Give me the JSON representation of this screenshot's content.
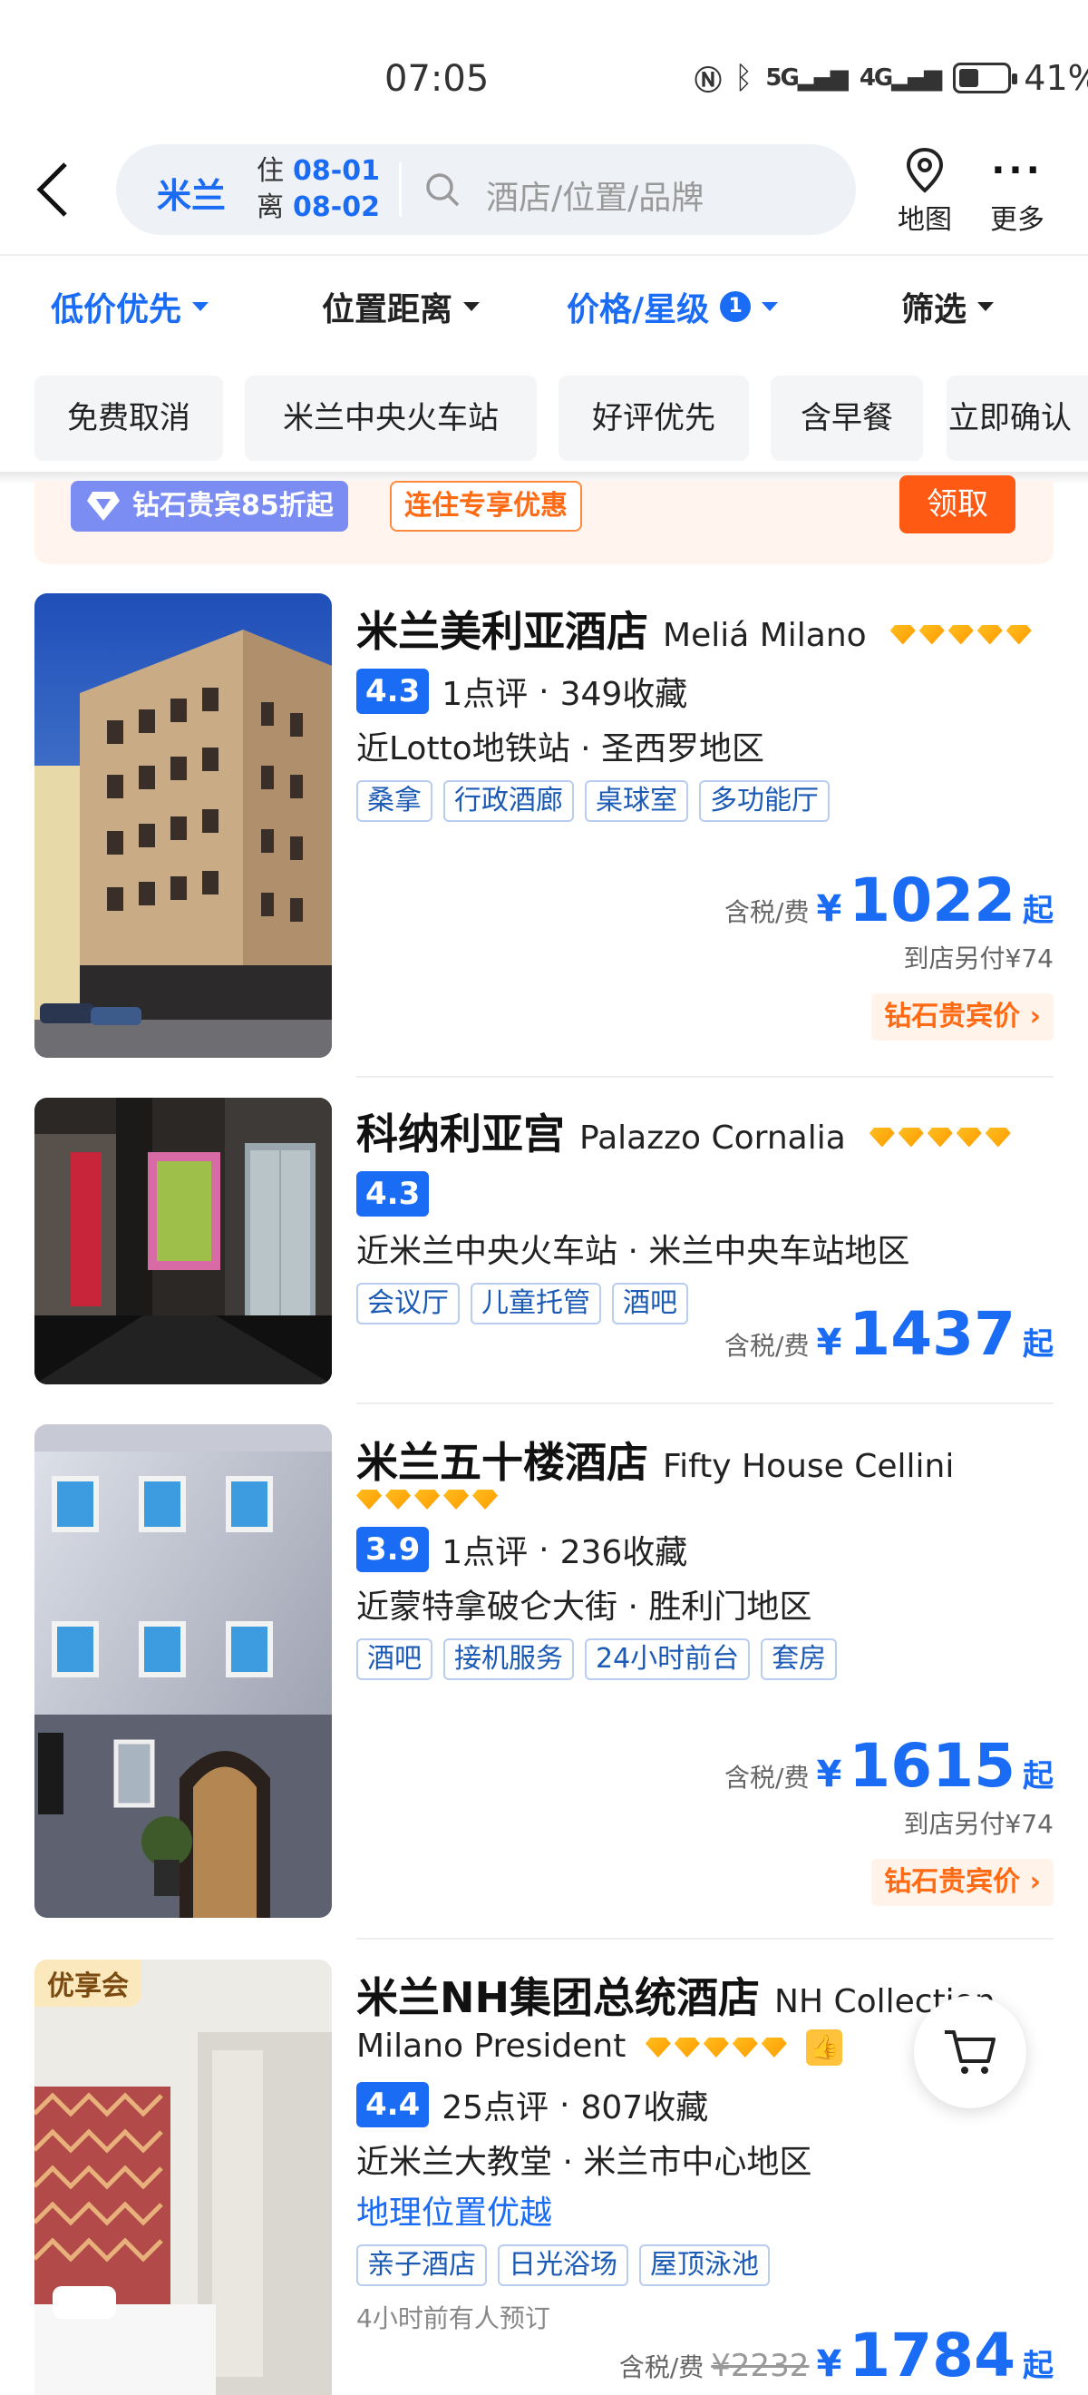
{
  "status_bar": {
    "time": "07:05",
    "battery_pct": "41%",
    "battery_level": 0.41,
    "signal_5g": "5G",
    "signal_4g": "4G"
  },
  "header": {
    "city": "米兰",
    "checkin_label": "住",
    "checkin_date": "08-01",
    "checkout_label": "离",
    "checkout_date": "08-02",
    "search_placeholder": "酒店/位置/品牌",
    "map_label": "地图",
    "more_label": "更多"
  },
  "filters": [
    {
      "label": "低价优先"
    },
    {
      "label": "位置距离"
    },
    {
      "label": "价格/星级",
      "badge": "1"
    },
    {
      "label": "筛选"
    }
  ],
  "quick_tags": [
    "免费取消",
    "米兰中央火车站",
    "好评优先",
    "含早餐",
    "立即确认"
  ],
  "promo": {
    "diamond": "钻石贵宾85折起",
    "stay": "连住专享优惠",
    "claim": "领取"
  },
  "common": {
    "tax_label": "含税/费",
    "currency": "¥",
    "qi": "起",
    "vip_price": "钻石贵宾价 ›"
  },
  "hotels": [
    {
      "name": "米兰美利亚酒店",
      "name_en": "Meliá Milano",
      "stars": 5,
      "score": "4.3",
      "reviews": "1点评",
      "favorites": "349收藏",
      "location": "近Lotto地铁站 · 圣西罗地区",
      "tags": [
        "桑拿",
        "行政酒廊",
        "桌球室",
        "多功能厅"
      ],
      "price": "1022",
      "extra": "到店另付¥74"
    },
    {
      "name": "科纳利亚宫",
      "name_en": "Palazzo Cornalia",
      "stars": 5,
      "score": "4.3",
      "location": "近米兰中央火车站 · 米兰中央车站地区",
      "tags": [
        "会议厅",
        "儿童托管",
        "酒吧"
      ],
      "price": "1437"
    },
    {
      "name": "米兰五十楼酒店",
      "name_en": "Fifty House Cellini",
      "stars": 5,
      "score": "3.9",
      "reviews": "1点评",
      "favorites": "236收藏",
      "location": "近蒙特拿破仑大街 · 胜利门地区",
      "tags": [
        "酒吧",
        "接机服务",
        "24小时前台",
        "套房"
      ],
      "price": "1615",
      "extra": "到店另付¥74"
    },
    {
      "name": "米兰NH集团总统酒店",
      "name_en_1": "NH Collection",
      "name_en_2": "Milano President",
      "stars": 5,
      "member_badge": "优享会",
      "score": "4.4",
      "reviews": "25点评",
      "favorites": "807收藏",
      "location": "近米兰大教堂 · 米兰市中心地区",
      "highlight": "地理位置优越",
      "tags": [
        "亲子酒店",
        "日光浴场",
        "屋顶泳池"
      ],
      "recent": "4小时前有人预订",
      "original_price": "¥2232",
      "price": "1784"
    }
  ],
  "icons": {
    "back": "chevron-left-icon",
    "search": "search-icon",
    "map": "map-pin-icon",
    "more": "more-dots-icon",
    "cart": "cart-icon",
    "diamond": "diamond-icon",
    "thumb": "thumb-up-icon"
  },
  "colors": {
    "accent": "#1b6cf5",
    "orange": "#ff5a14",
    "star": "#ffb300"
  }
}
